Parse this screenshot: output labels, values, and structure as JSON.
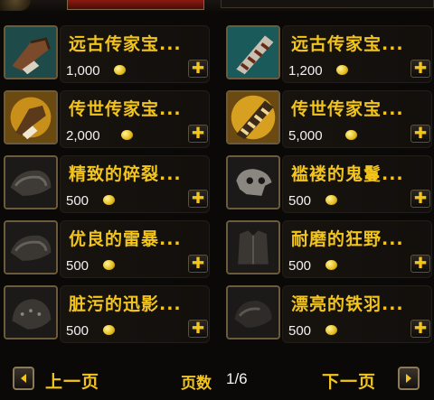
{
  "items": [
    {
      "name": "远古传家宝...",
      "price": "1,000",
      "icon": "leather-glove-icon"
    },
    {
      "name": "远古传家宝...",
      "price": "1,200",
      "icon": "bound-scroll-icon"
    },
    {
      "name": "传世传家宝...",
      "price": "2,000",
      "icon": "gold-gauntlet-icon"
    },
    {
      "name": "传世传家宝...",
      "price": "5,000",
      "icon": "gold-bound-scroll-icon"
    },
    {
      "name": "精致的碎裂...",
      "price": "500",
      "icon": "shoulder-armor-icon"
    },
    {
      "name": "褴褛的鬼鬘...",
      "price": "500",
      "icon": "beast-skull-icon"
    },
    {
      "name": "优良的雷暴...",
      "price": "500",
      "icon": "shoulder-armor-icon"
    },
    {
      "name": "耐磨的狂野...",
      "price": "500",
      "icon": "armor-vest-icon"
    },
    {
      "name": "脏污的迅影...",
      "price": "500",
      "icon": "studded-armor-icon"
    },
    {
      "name": "漂亮的铁羽...",
      "price": "500",
      "icon": "dark-pauldron-icon"
    }
  ],
  "footer": {
    "prev_label": "上一页",
    "next_label": "下一页",
    "page_label": "页数",
    "page_value": "1/6"
  }
}
